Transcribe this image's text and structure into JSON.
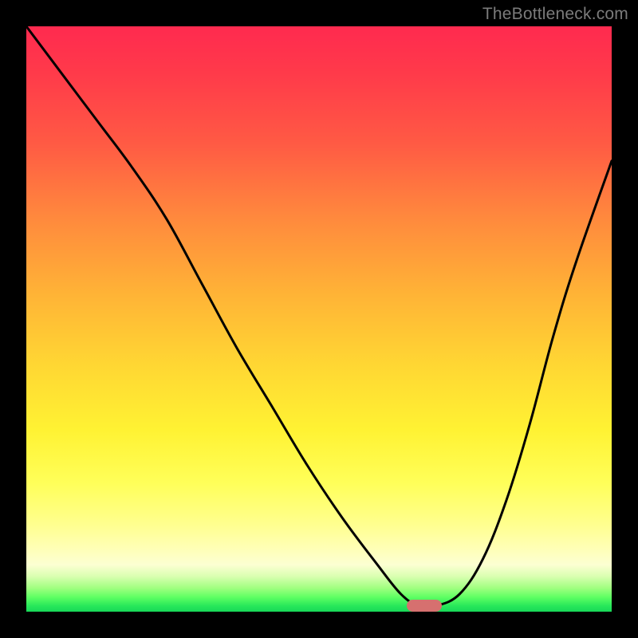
{
  "watermark": "TheBottleneck.com",
  "marker": {
    "x_frac": 0.678,
    "y_frac": 0.985
  },
  "colors": {
    "background": "#000000",
    "marker": "#d6706f",
    "watermark": "#7b7b7b",
    "gradient_top": "#ff2a4f",
    "gradient_bottom": "#18d858"
  },
  "chart_data": {
    "type": "line",
    "title": "",
    "xlabel": "",
    "ylabel": "",
    "xlim": [
      0,
      100
    ],
    "ylim": [
      0,
      100
    ],
    "grid": false,
    "series": [
      {
        "name": "bottleneck-curve",
        "x": [
          0,
          6,
          12,
          18,
          24,
          30,
          36,
          42,
          48,
          54,
          60,
          64,
          67,
          70,
          74,
          78,
          82,
          86,
          90,
          94,
          100
        ],
        "y": [
          100,
          92,
          84,
          76,
          67,
          56,
          45,
          35,
          25,
          16,
          8,
          3,
          1,
          1,
          3,
          9,
          19,
          32,
          47,
          60,
          77
        ]
      }
    ],
    "annotations": [
      {
        "name": "optimal-marker",
        "x": 68,
        "y": 1
      }
    ],
    "note": "y is plotted top-to-bottom (higher y = closer to top / red). Background is a red→yellow→green gradient. Values are visual estimates from an unlabeled chart."
  }
}
